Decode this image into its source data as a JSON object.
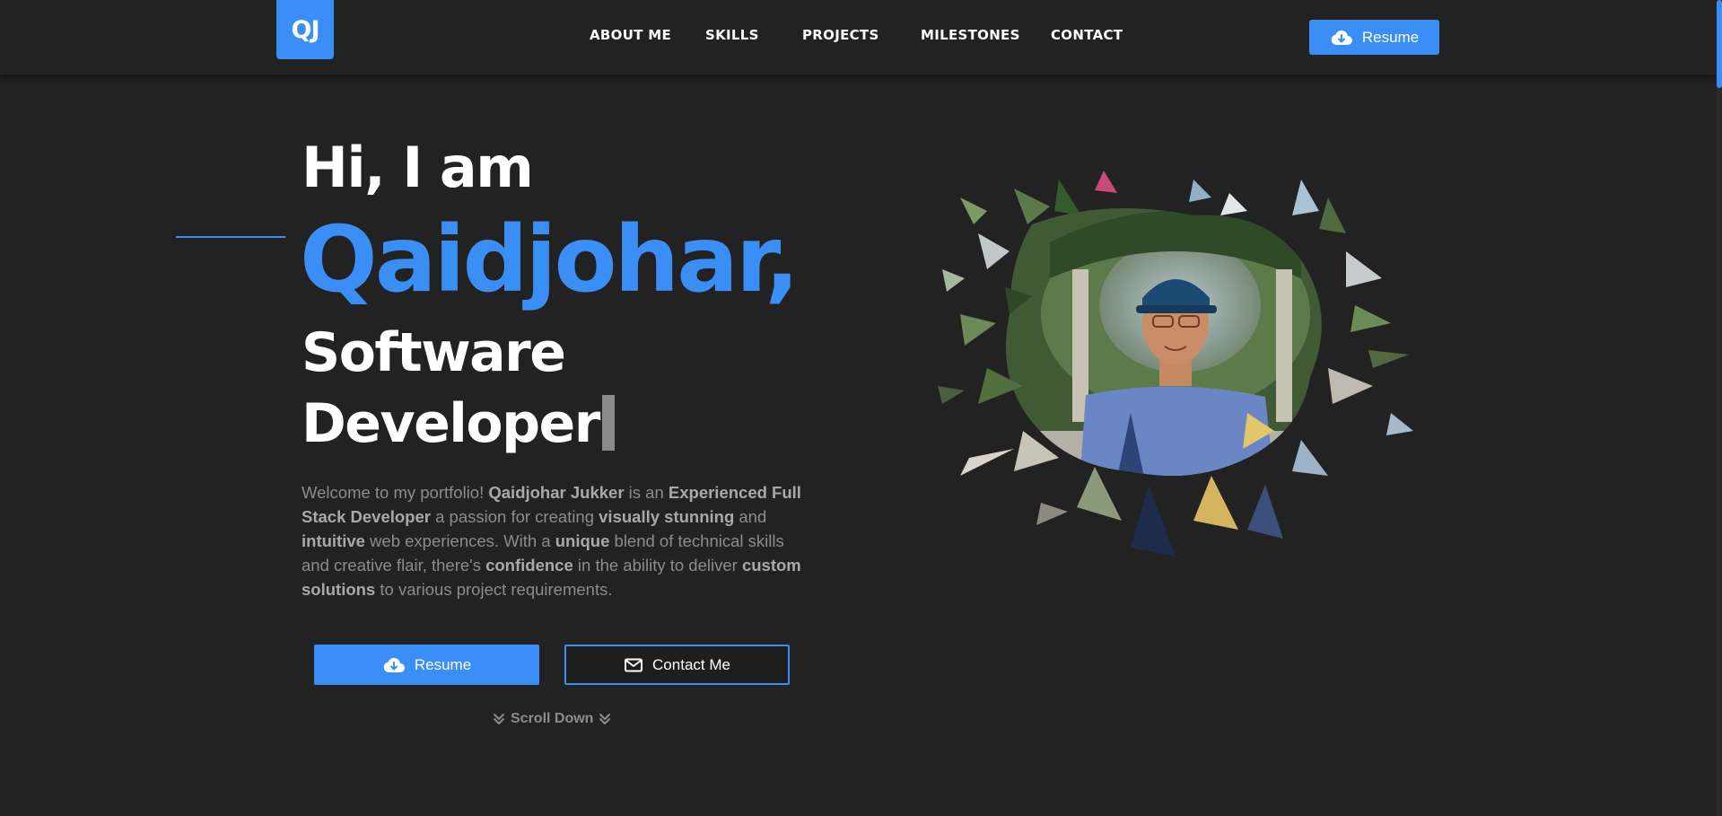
{
  "header": {
    "logo_text": "QJ",
    "nav": [
      "ABOUT ME",
      "SKILLS",
      "PROJECTS",
      "MILESTONES",
      "CONTACT"
    ],
    "resume_label": "Resume"
  },
  "hero": {
    "greeting": "Hi, I am",
    "name": "Qaidjohar,",
    "role_line1": "Software",
    "role_line2": "Developer",
    "bio": {
      "p1": "Welcome to my portfolio! ",
      "b1": "Qaidjohar Jukker",
      "p2": " is an ",
      "b2": "Experienced Full Stack Developer",
      "p3": " a passion for creating ",
      "b3": "visually stunning",
      "p4": " and ",
      "b4": "intuitive",
      "p5": " web experiences. With a ",
      "b5": "unique",
      "p6": " blend of technical skills and creative flair, there's ",
      "b6": "confidence",
      "p7": " in the ability to deliver ",
      "b7": "custom solutions",
      "p8": " to various project requirements."
    },
    "resume_button": "Resume",
    "contact_button": "Contact Me",
    "scroll_label": "Scroll Down"
  },
  "icons": {
    "download": "cloud-download-icon",
    "mail": "mail-icon",
    "chevrons": "chevrons-down-icon"
  },
  "colors": {
    "background": "#222222",
    "accent": "#3a8ef6",
    "text": "#ffffff",
    "muted": "#8c8c8c"
  }
}
